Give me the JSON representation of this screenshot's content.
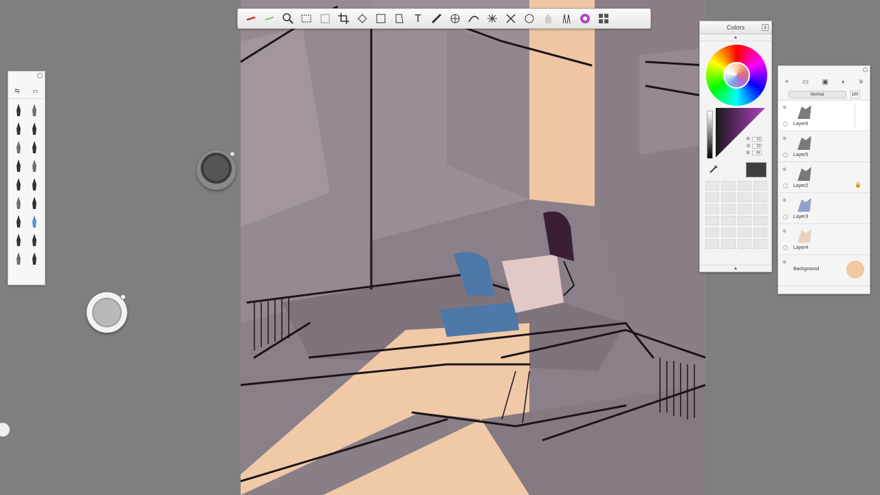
{
  "toolbar": {
    "tools": [
      {
        "icon": "red-brush-icon"
      },
      {
        "icon": "green-brush-icon"
      },
      {
        "icon": "zoom-icon"
      },
      {
        "icon": "select-icon"
      },
      {
        "icon": "transform-icon"
      },
      {
        "icon": "crop-icon"
      },
      {
        "icon": "symmetry-icon"
      },
      {
        "icon": "shape-icon"
      },
      {
        "icon": "fill-icon"
      },
      {
        "icon": "text-icon",
        "label": "T"
      },
      {
        "icon": "ruler-icon"
      },
      {
        "icon": "ellipse-guide-icon"
      },
      {
        "icon": "curve-guide-icon"
      },
      {
        "icon": "perspective-icon"
      },
      {
        "icon": "distort-icon"
      },
      {
        "icon": "stencil-icon"
      },
      {
        "icon": "hand-icon"
      },
      {
        "icon": "brush-library-icon"
      },
      {
        "icon": "color-wheel-icon"
      },
      {
        "icon": "layers-icon"
      }
    ]
  },
  "brush_palette": {
    "header_icons": [
      "swap-icon",
      "preset-icon"
    ],
    "brushes": [
      "airbrush-icon",
      "text-brush-icon",
      "pencil-icon",
      "marker-icon",
      "pen-icon",
      "ballpoint-icon",
      "paintbrush-icon",
      "flat-brush-icon",
      "eraser-icon",
      "smudge-icon",
      "chisel-icon",
      "fill-brush-icon",
      "calligraphy-icon",
      "blender-icon",
      "stamp-icon",
      "hand-tool-icon",
      "ink-icon",
      "wedge-icon"
    ]
  },
  "colors_panel": {
    "title": "Colors",
    "close": "x",
    "rgb": [
      {
        "label": "R:",
        "value": "63"
      },
      {
        "label": "G:",
        "value": "63"
      },
      {
        "label": "B:",
        "value": "64"
      }
    ],
    "current_color": "#3f3f40",
    "accent": "#b142c4"
  },
  "layers_panel": {
    "blend_mode": "Normal",
    "opacity": "100",
    "layers": [
      {
        "name": "Layer6",
        "active": true,
        "locked": false
      },
      {
        "name": "Layer5",
        "active": false,
        "locked": false
      },
      {
        "name": "Layer2",
        "active": false,
        "locked": true
      },
      {
        "name": "Layer3",
        "active": false,
        "locked": false
      },
      {
        "name": "Layer4",
        "active": false,
        "locked": false
      }
    ],
    "background": {
      "name": "Background",
      "color": "#f1c8a1"
    }
  },
  "pucks": {
    "dark_color": "#444444",
    "light_color": "#b8b8b8"
  }
}
